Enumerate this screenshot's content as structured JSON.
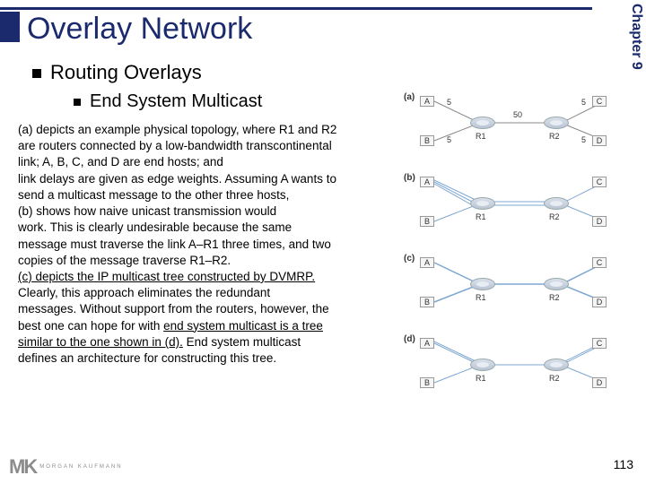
{
  "chapter": "Chapter 9",
  "title": "Overlay Network",
  "sub1": "Routing Overlays",
  "sub2": "End System Multicast",
  "body_lines": [
    "(a) depicts an example physical topology, where R1 and R2",
    "are routers connected by a low-bandwidth transcontinental",
    "link; A, B, C, and D are end hosts; and",
    "link delays are given as edge weights. Assuming A wants to",
    "send a multicast message to the other three hosts,",
    "(b) shows how naive unicast transmission would",
    "work. This is clearly undesirable because the same",
    "message must traverse the link A–R1 three times, and two",
    "copies of the message traverse R1–R2."
  ],
  "body_u1": "(c) depicts the IP multicast tree constructed by DVMRP.",
  "body_lines2": [
    "Clearly, this approach eliminates the redundant",
    "messages. Without support from the routers, however, the"
  ],
  "body_u2_a": "best one can hope for with ",
  "body_u2_b": "end system multicast is a tree",
  "body_u3_a": "similar to the one shown in (d).",
  "body_u3_b": " End system multicast",
  "body_last": "defines an architecture for constructing this tree.",
  "fig": {
    "panels": [
      "(a)",
      "(b)",
      "(c)",
      "(d)"
    ],
    "hosts": [
      "A",
      "B",
      "C",
      "D"
    ],
    "routers": [
      "R1",
      "R2"
    ],
    "weights": {
      "a_r1": "5",
      "b_r1": "5",
      "r1_r2": "50",
      "r2_c": "5",
      "r2_d": "5"
    }
  },
  "logo": {
    "mk": "MK",
    "brand": "MORGAN KAUFMANN"
  },
  "page": "113"
}
